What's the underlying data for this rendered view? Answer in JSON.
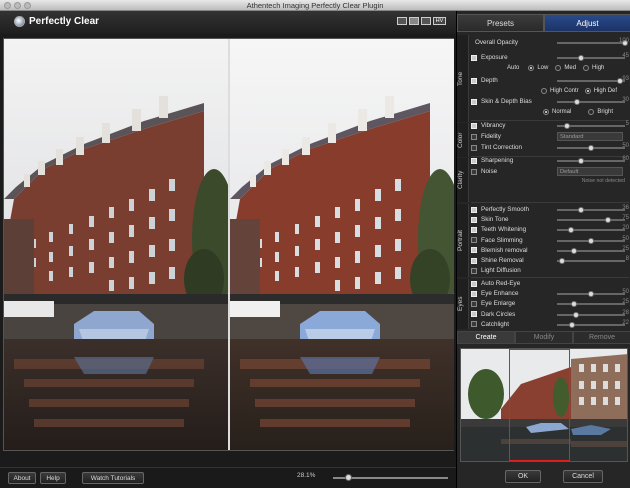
{
  "window": {
    "title": "Athentech Imaging Perfectly Clear Plugin"
  },
  "app": {
    "logo_text": "Perfectly Clear",
    "hv_label": "HV"
  },
  "bottom": {
    "about": "About",
    "help": "Help",
    "tutorials": "Watch Tutorials",
    "zoom_text": "28.1%",
    "zoom_fraction": 0.1
  },
  "tabs": [
    {
      "label": "Presets",
      "active": false
    },
    {
      "label": "Adjust",
      "active": true
    }
  ],
  "overall_opacity": {
    "label": "Overall Opacity",
    "value": "100",
    "fraction": 1.0
  },
  "sections": {
    "tone": "Tone",
    "color": "Color",
    "clarity": "Clarity",
    "portrait": "Portrait",
    "eyes": "Eyes"
  },
  "tone": {
    "exposure": {
      "label": "Exposure",
      "value": "45",
      "fraction": 0.35,
      "checked": true
    },
    "exposure_modes": {
      "auto": "Auto",
      "low": "Low",
      "med": "Med",
      "high": "High",
      "selected": "low"
    },
    "depth": {
      "label": "Depth",
      "value": "93",
      "fraction": 0.93,
      "checked": true
    },
    "depth_modes": {
      "high_contr": "High Contr",
      "high_def": "High Def",
      "selected": "high_def"
    },
    "skin_depth_bias": {
      "label": "Skin & Depth Bias",
      "value": "30",
      "fraction": 0.3,
      "checked": true
    },
    "bias_modes": {
      "normal": "Normal",
      "bright": "Bright",
      "selected": "normal"
    }
  },
  "color": {
    "vibrancy": {
      "label": "Vibrancy",
      "value": "5",
      "fraction": 0.15,
      "checked": true
    },
    "fidelity": {
      "label": "Fidelity",
      "option": "Standard",
      "checked": false
    },
    "tint_correction": {
      "label": "Tint Correction",
      "value": "50",
      "fraction": 0.5,
      "checked": false
    }
  },
  "clarity": {
    "sharpening": {
      "label": "Sharpening",
      "value": "60",
      "fraction": 0.35,
      "checked": true
    },
    "noise": {
      "label": "Noise",
      "option": "Default",
      "checked": false
    },
    "noise_note": "Noise not detected"
  },
  "portrait": [
    {
      "label": "Perfectly Smooth",
      "value": "36",
      "fraction": 0.36,
      "checked": true
    },
    {
      "label": "Skin Tone",
      "value": "75",
      "fraction": 0.75,
      "checked": true
    },
    {
      "label": "Teeth Whitening",
      "value": "20",
      "fraction": 0.2,
      "checked": true
    },
    {
      "label": "Face Slimming",
      "value": "50",
      "fraction": 0.5,
      "checked": false
    },
    {
      "label": "Blemish removal",
      "value": "25",
      "fraction": 0.25,
      "checked": true
    },
    {
      "label": "Shine Removal",
      "value": "8",
      "fraction": 0.08,
      "checked": true
    },
    {
      "label": "Light Diffusion",
      "value": "",
      "fraction": null,
      "checked": false
    }
  ],
  "eyes": [
    {
      "label": "Auto Red-Eye",
      "value": "",
      "fraction": null,
      "checked": true
    },
    {
      "label": "Eye Enhance",
      "value": "50",
      "fraction": 0.5,
      "checked": true
    },
    {
      "label": "Eye Enlarge",
      "value": "25",
      "fraction": 0.25,
      "checked": false
    },
    {
      "label": "Dark Circles",
      "value": "28",
      "fraction": 0.28,
      "checked": true
    },
    {
      "label": "Catchlight",
      "value": "22",
      "fraction": 0.22,
      "checked": false
    }
  ],
  "presets": {
    "create": "Create",
    "modify": "Modify",
    "remove": "Remove"
  },
  "actions": {
    "ok": "OK",
    "cancel": "Cancel"
  }
}
